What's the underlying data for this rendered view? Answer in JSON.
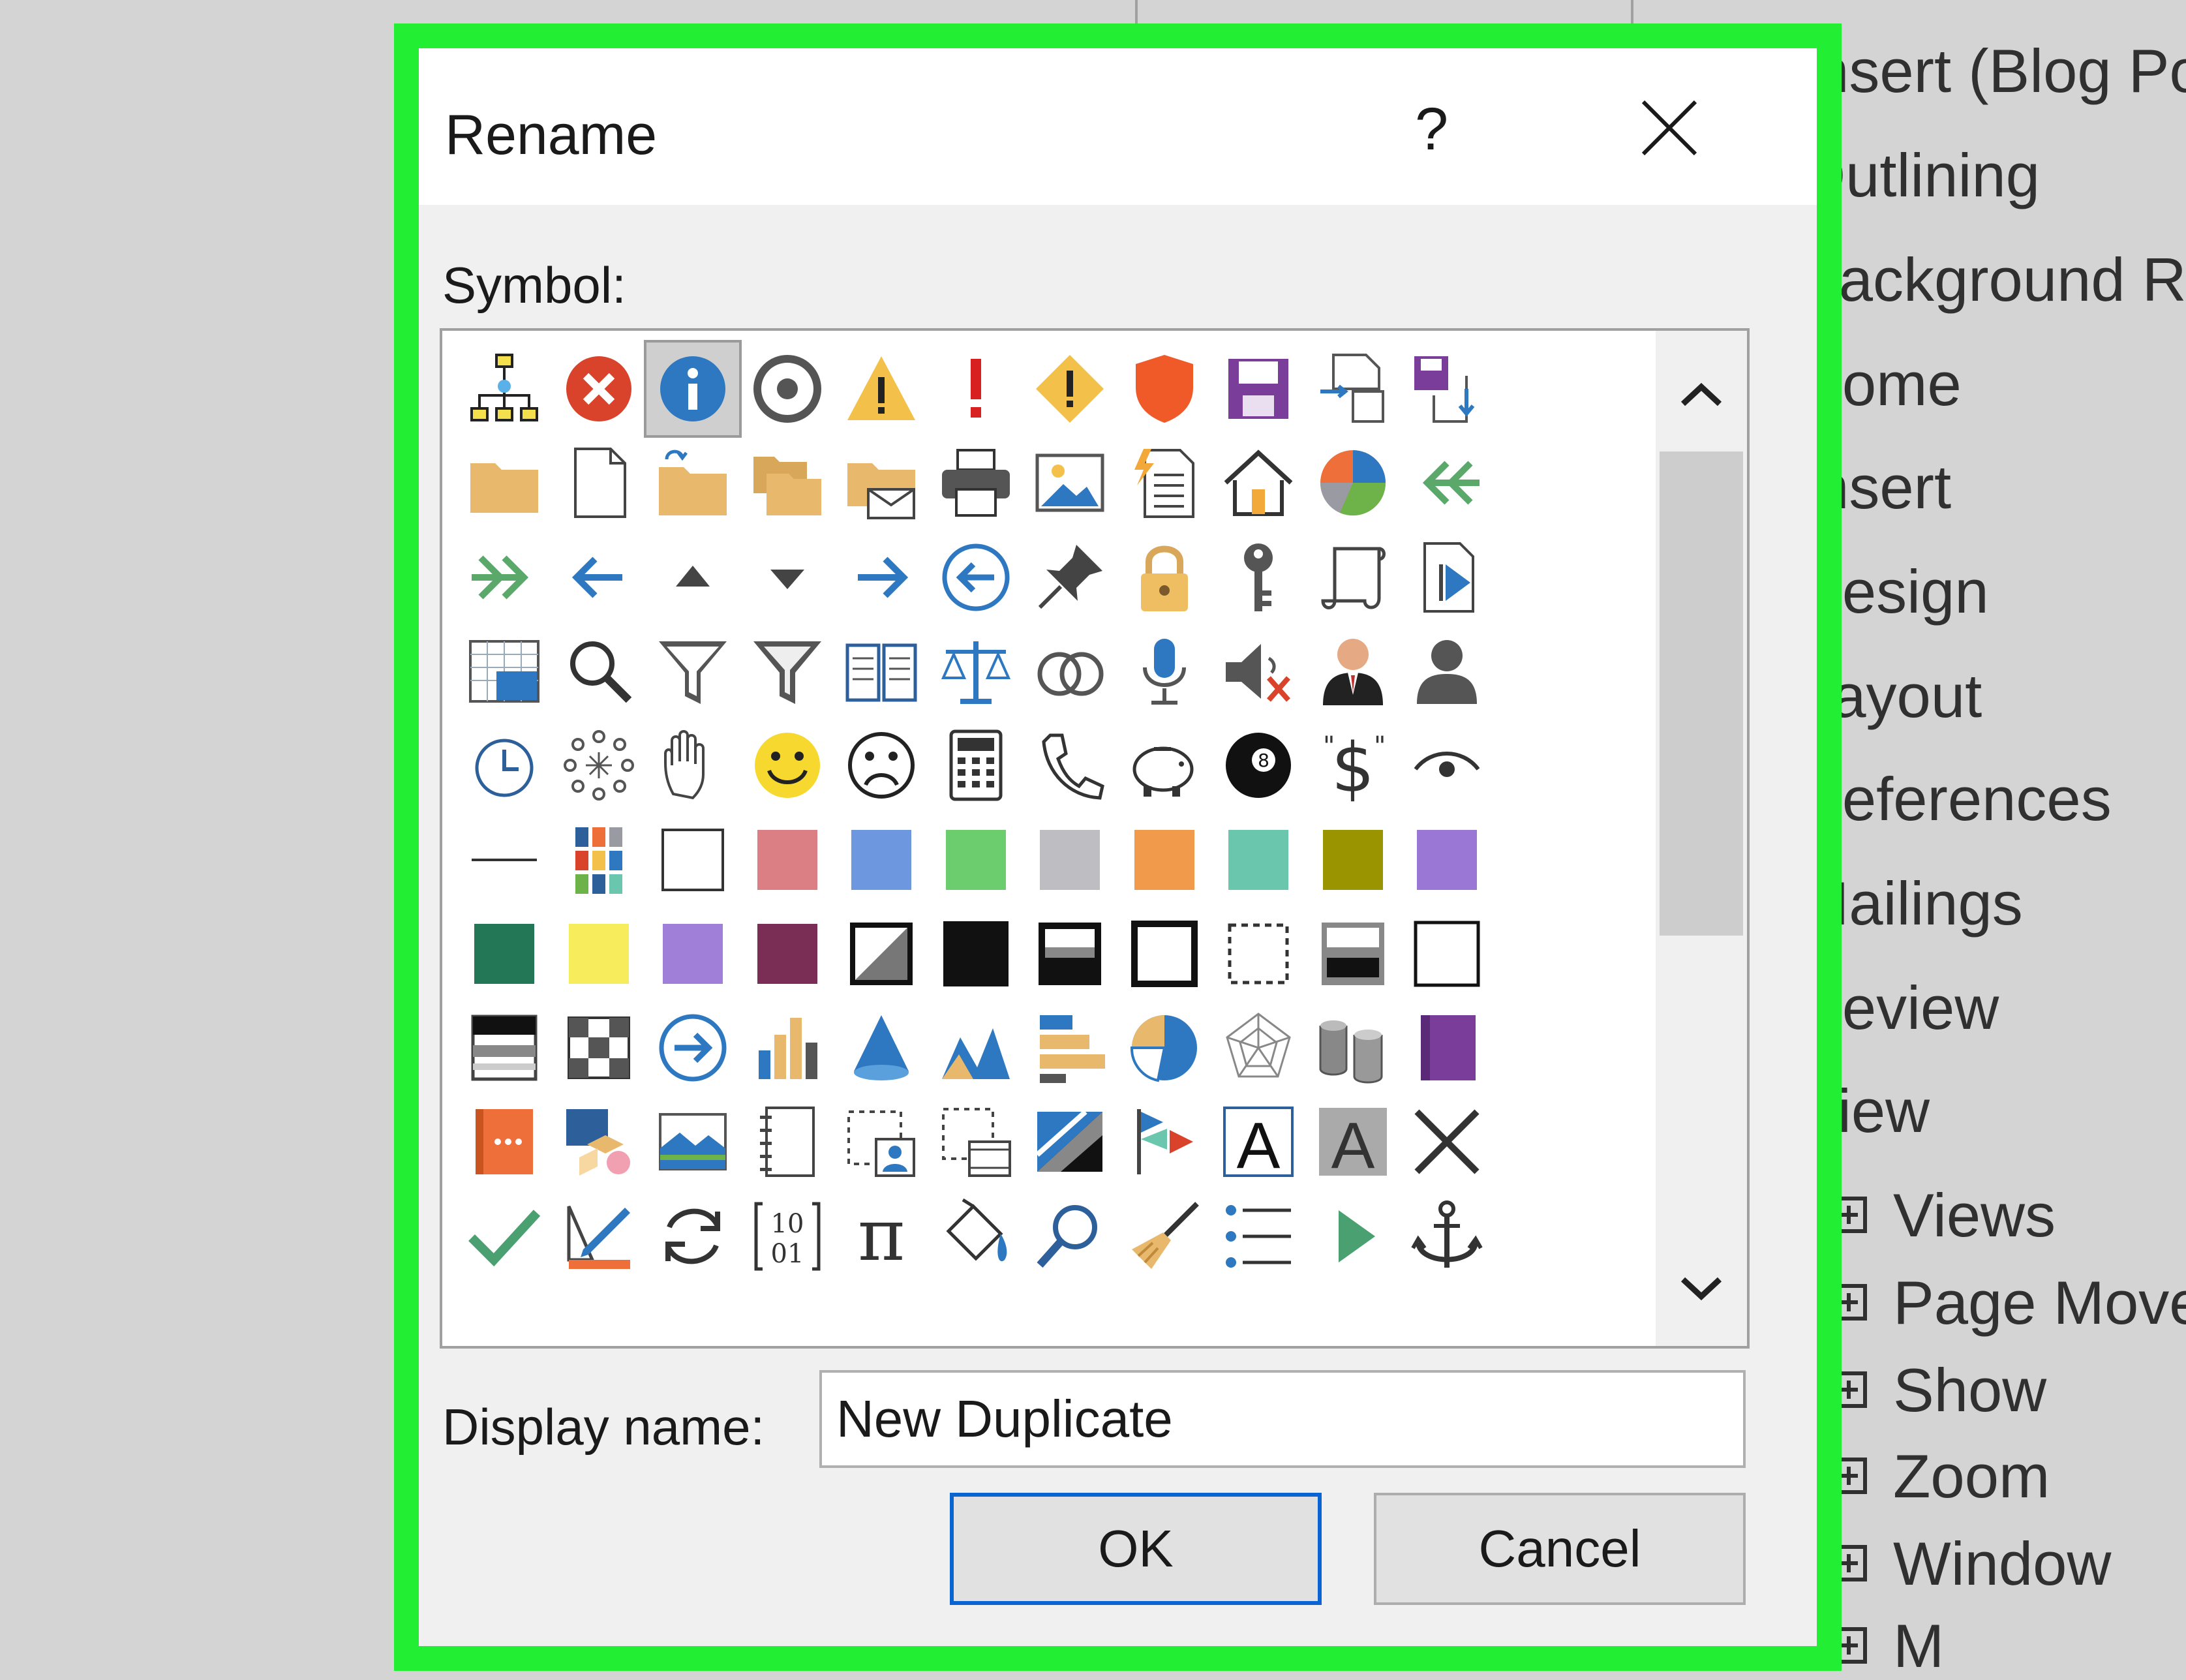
{
  "dialog": {
    "title": "Rename",
    "help_label": "?",
    "close_icon": "close-icon",
    "symbol_label": "Symbol:",
    "display_name_label": "Display name:",
    "display_name_value": "New Duplicate",
    "ok_label": "OK",
    "cancel_label": "Cancel",
    "selected_symbol": "info-icon",
    "scroll_up_icon": "chevron-up-icon",
    "scroll_down_icon": "chevron-down-icon",
    "highlight_color": "#22ee33"
  },
  "background_list": {
    "items": [
      "Insert (Blog Po",
      "Outlining",
      "Background Re",
      "Home",
      "Insert",
      "Design",
      "Layout",
      "References",
      "Mailings",
      "Review",
      "View"
    ],
    "subitems": [
      "Views",
      "Page Move",
      "Show",
      "Zoom",
      "Window",
      "M"
    ]
  },
  "symbols": [
    [
      "org-chart-icon",
      "error-icon",
      "info-icon",
      "target-icon",
      "warning-triangle-icon",
      "exclamation-icon",
      "warning-diamond-icon",
      "shield-icon",
      "save-icon",
      "document-convert-icon",
      "save-sync-icon"
    ],
    [
      "folder-icon",
      "blank-page-icon",
      "folder-upload-icon",
      "folders-icon",
      "folder-mail-icon",
      "printer-icon",
      "picture-icon",
      "document-flash-icon",
      "home-icon",
      "pie-chart-icon",
      "double-chevron-left-icon"
    ],
    [
      "double-chevron-right-icon",
      "arrow-left-icon",
      "triangle-up-icon",
      "triangle-down-icon",
      "arrow-right-icon",
      "circle-arrow-left-icon",
      "pushpin-icon",
      "lock-icon",
      "key-icon",
      "scroll-icon",
      "document-play-icon"
    ],
    [
      "table-window-icon",
      "magnifier-icon",
      "filter-icon",
      "filter-alt-icon",
      "book-icon",
      "scales-icon",
      "rings-icon",
      "microphone-icon",
      "speaker-mute-icon",
      "person-suit-icon",
      "person-icon"
    ],
    [
      "clock-icon",
      "loading-dots-icon",
      "hand-icon",
      "smiley-happy-icon",
      "smiley-sad-icon",
      "calculator-icon",
      "phone-icon",
      "piggy-bank-icon",
      "eight-ball-icon",
      "dollar-quote-icon",
      "eye-icon"
    ],
    [
      "line-icon",
      "color-grid-icon",
      "white-swatch-icon",
      "rose-swatch-icon",
      "blue-swatch-icon",
      "green-swatch-icon",
      "gray-swatch-icon",
      "orange-swatch-icon",
      "teal-swatch-icon",
      "olive-swatch-icon",
      "purple-swatch-icon"
    ],
    [
      "dark-green-swatch-icon",
      "yellow-swatch-icon",
      "lavender-swatch-icon",
      "maroon-swatch-icon",
      "diagonal-split-icon",
      "black-swatch-icon",
      "header-box-icon",
      "outline-box-icon",
      "dashed-box-icon",
      "footer-box-icon",
      "empty-box-icon"
    ],
    [
      "striped-box-icon",
      "checker-icon",
      "circle-arrow-right-icon",
      "bar-chart-icon",
      "cone-icon",
      "area-chart-icon",
      "bar-horizontal-icon",
      "pie-slice-icon",
      "radar-chart-icon",
      "database-icon",
      "purple-book-icon"
    ],
    [
      "orange-book-icon",
      "shapes-icon",
      "landscape-icon",
      "notebook-icon",
      "dashed-person-icon",
      "dashed-video-icon",
      "diagonal-stripes-icon",
      "flags-icon",
      "text-a-outline-icon",
      "text-a-fill-icon",
      "x-mark-icon"
    ],
    [
      "checkmark-icon",
      "ruler-pencil-icon",
      "refresh-icon",
      "binary-icon",
      "pi-icon",
      "paint-bucket-icon",
      "search-small-icon",
      "broom-icon",
      "bullet-list-icon",
      "play-icon",
      "anchor-icon"
    ]
  ],
  "swatch_colors": {
    "rose": "#dc7f84",
    "blue": "#6d98e0",
    "green": "#6ccd6e",
    "gray": "#bdbdc2",
    "orange": "#f19a4c",
    "teal": "#6ac6ad",
    "olive": "#9a9400",
    "purple": "#9a77d4",
    "dark_green": "#237656",
    "yellow": "#f6ec5c",
    "lavender": "#9f7fd8",
    "maroon": "#7a2e55"
  }
}
